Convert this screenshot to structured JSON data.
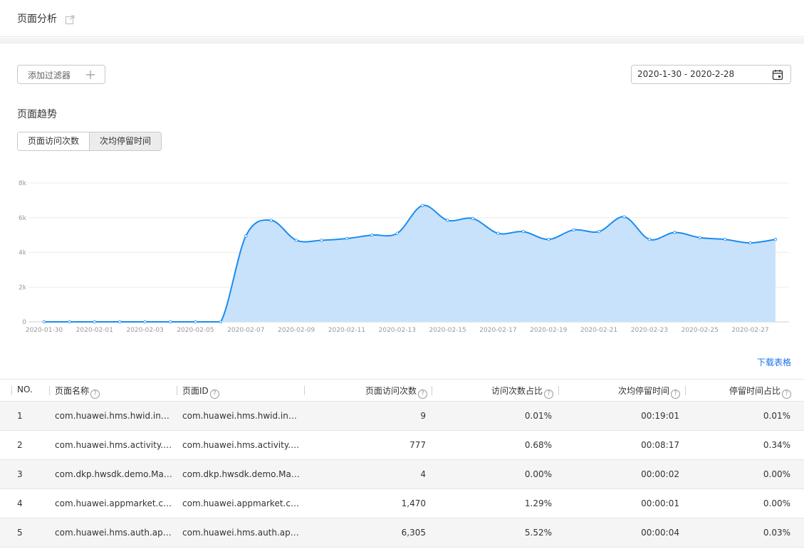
{
  "header": {
    "title": "页面分析"
  },
  "filter": {
    "label": "添加过滤器"
  },
  "date_range": {
    "value": "2020-1-30 - 2020-2-28"
  },
  "trend": {
    "title": "页面趋势",
    "tabs": [
      {
        "label": "页面访问次数"
      },
      {
        "label": "次均停留时间"
      }
    ]
  },
  "chart_data": {
    "type": "area",
    "x": [
      "2020-01-30",
      "2020-01-31",
      "2020-02-01",
      "2020-02-02",
      "2020-02-03",
      "2020-02-04",
      "2020-02-05",
      "2020-02-06",
      "2020-02-07",
      "2020-02-08",
      "2020-02-09",
      "2020-02-10",
      "2020-02-11",
      "2020-02-12",
      "2020-02-13",
      "2020-02-14",
      "2020-02-15",
      "2020-02-16",
      "2020-02-17",
      "2020-02-18",
      "2020-02-19",
      "2020-02-20",
      "2020-02-21",
      "2020-02-22",
      "2020-02-23",
      "2020-02-24",
      "2020-02-25",
      "2020-02-26",
      "2020-02-27",
      "2020-02-28"
    ],
    "x_ticks": [
      "2020-01-30",
      "2020-02-01",
      "2020-02-03",
      "2020-02-05",
      "2020-02-07",
      "2020-02-09",
      "2020-02-11",
      "2020-02-13",
      "2020-02-15",
      "2020-02-17",
      "2020-02-19",
      "2020-02-21",
      "2020-02-23",
      "2020-02-25",
      "2020-02-27"
    ],
    "y_ticks": [
      "0",
      "2k",
      "4k",
      "6k",
      "8k"
    ],
    "ylim": [
      0,
      8000
    ],
    "series": [
      {
        "values": [
          0,
          0,
          0,
          0,
          0,
          0,
          0,
          0,
          4950,
          5850,
          4700,
          4700,
          4800,
          5000,
          5100,
          6700,
          5850,
          5950,
          5100,
          5200,
          4750,
          5300,
          5200,
          6050,
          4750,
          5150,
          4850,
          4750,
          4550,
          4750
        ]
      }
    ],
    "line_color": "#1a8cf0",
    "fill_color": "#c9e2fb",
    "grid": true
  },
  "download": {
    "label": "下载表格"
  },
  "table": {
    "headers": {
      "no": "NO.",
      "name": "页面名称",
      "id": "页面ID",
      "visits": "页面访问次数",
      "visit_pct": "访问次数占比",
      "avg_time": "次均停留时间",
      "time_pct": "停留时间占比"
    },
    "help_icon": "?",
    "rows": [
      {
        "no": "1",
        "name": "com.huawei.hms.hwid.internal.ui.activity.HwIdSignInHubActivity",
        "id": "com.huawei.hms.hwid.internal.ui.activity.HwIdSignInHubActivity",
        "visits": "9",
        "visit_pct": "0.01%",
        "avg_time": "00:19:01",
        "time_pct": "0.01%"
      },
      {
        "no": "2",
        "name": "com.huawei.hms.activity.BridgeActivity",
        "id": "com.huawei.hms.activity.BridgeActivity",
        "visits": "777",
        "visit_pct": "0.68%",
        "avg_time": "00:08:17",
        "time_pct": "0.34%"
      },
      {
        "no": "3",
        "name": "com.dkp.hwsdk.demo.MainActivity",
        "id": "com.dkp.hwsdk.demo.MainActivity",
        "visits": "4",
        "visit_pct": "0.00%",
        "avg_time": "00:00:02",
        "time_pct": "0.00%"
      },
      {
        "no": "4",
        "name": "com.huawei.appmarket.component.buoycircle.impl.delegete.BuoyBridgeActivity",
        "id": "com.huawei.appmarket.component.buoycircle.impl.delegete.BuoyBridgeActivity",
        "visits": "1,470",
        "visit_pct": "1.29%",
        "avg_time": "00:00:01",
        "time_pct": "0.00%"
      },
      {
        "no": "5",
        "name": "com.huawei.hms.auth.api.signin.internal.SignInHubActivity",
        "id": "com.huawei.hms.auth.api.signin.internal.SignInHubActivity",
        "visits": "6,305",
        "visit_pct": "5.52%",
        "avg_time": "00:00:04",
        "time_pct": "0.03%"
      }
    ]
  }
}
